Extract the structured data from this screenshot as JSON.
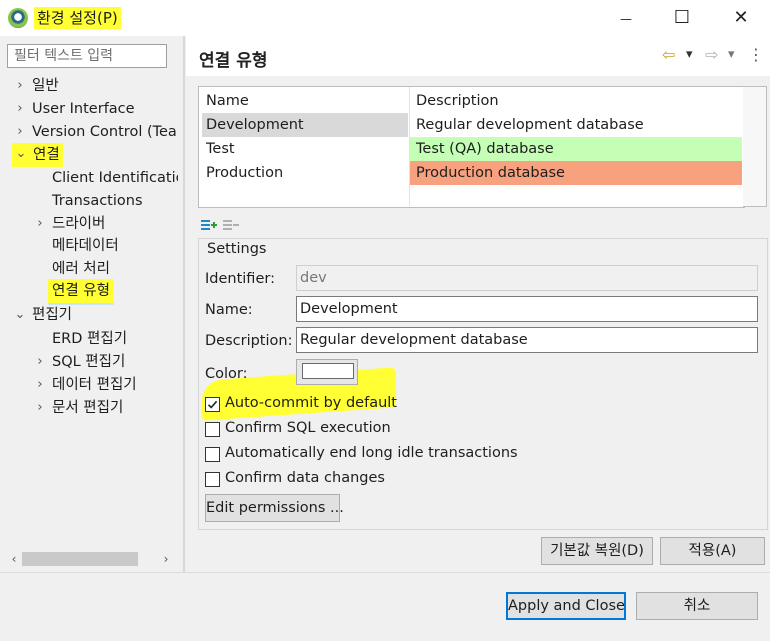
{
  "window": {
    "title": "환경 설정(P)",
    "minimize_glyph": "—",
    "maximize_glyph": "☐",
    "close_glyph": "✕"
  },
  "sidebar": {
    "filter_placeholder": "필터 텍스트 입력",
    "items": [
      {
        "label": "일반",
        "chevron": "›"
      },
      {
        "label": "User Interface",
        "chevron": "›"
      },
      {
        "label": "Version Control (Tea",
        "chevron": "›"
      },
      {
        "label": "연결",
        "chevron": "⌄"
      },
      {
        "label": "Client Identificatic"
      },
      {
        "label": "Transactions"
      },
      {
        "label": "드라이버",
        "chevron": "›"
      },
      {
        "label": "메타데이터"
      },
      {
        "label": "에러 처리"
      },
      {
        "label": "연결 유형"
      },
      {
        "label": "편집기",
        "chevron": "⌄"
      },
      {
        "label": "ERD 편집기"
      },
      {
        "label": "SQL 편집기",
        "chevron": "›"
      },
      {
        "label": "데이터 편집기",
        "chevron": "›"
      },
      {
        "label": "문서 편집기",
        "chevron": "›"
      }
    ],
    "scroll_left": "‹",
    "scroll_right": "›"
  },
  "page": {
    "title": "연결 유형",
    "nav": {
      "back": "⇦",
      "forward": "⇨",
      "dropdown": "▾",
      "menu": "⋮"
    }
  },
  "type_table": {
    "headers": [
      "Name",
      "Description"
    ],
    "rows": [
      {
        "name": "Development",
        "description": "Regular development database",
        "color": "#ffffff",
        "selected": true
      },
      {
        "name": "Test",
        "description": "Test (QA) database",
        "color": "#c4ffb5"
      },
      {
        "name": "Production",
        "description": "Production database",
        "color": "#f7a17e"
      }
    ],
    "selected_bg": "#d9d9d9"
  },
  "settings": {
    "group_label": "Settings",
    "identifier_label": "Identifier:",
    "identifier_value": "dev",
    "name_label": "Name:",
    "name_value": "Development",
    "description_label": "Description:",
    "description_value": "Regular development database",
    "color_label": "Color:",
    "color_value": "#ffffff",
    "checkboxes": [
      {
        "label": "Auto-commit by default",
        "checked": true
      },
      {
        "label": "Confirm SQL execution",
        "checked": false
      },
      {
        "label": "Automatically end long idle transactions",
        "checked": false
      },
      {
        "label": "Confirm data changes",
        "checked": false
      }
    ],
    "edit_permissions_label": "Edit permissions ..."
  },
  "buttons": {
    "restore_defaults": "기본값 복원(D)",
    "apply": "적용(A)",
    "apply_close": "Apply and Close",
    "cancel": "취소"
  },
  "colors": {
    "highlight": "#ffff33",
    "focus_border": "#0078d7"
  }
}
